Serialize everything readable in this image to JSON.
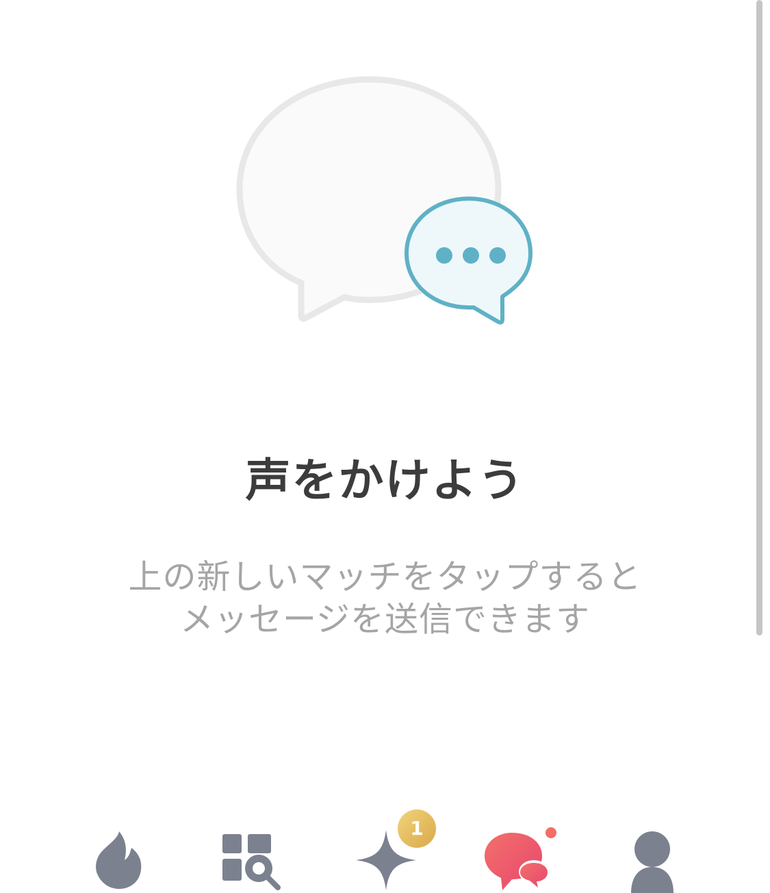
{
  "empty_state": {
    "title": "声をかけよう",
    "subtitle_line1": "上の新しいマッチをタップすると",
    "subtitle_line2": "メッセージを送信できます",
    "illustration_icon": "chat-bubbles-icon",
    "colors": {
      "bubble_outline": "#e6e6e6",
      "bubble_fill": "#fafafa",
      "accent_outline": "#5fb1c6",
      "accent_fill": "#eef8fb"
    }
  },
  "tabbar": {
    "tabs": [
      {
        "id": "home",
        "icon": "flame-icon",
        "active": false
      },
      {
        "id": "explore",
        "icon": "explore-search-icon",
        "active": false
      },
      {
        "id": "gold",
        "icon": "sparkle-icon",
        "active": false,
        "badge": "1"
      },
      {
        "id": "messages",
        "icon": "chat-icon",
        "active": true,
        "has_notification": true
      },
      {
        "id": "profile",
        "icon": "person-icon",
        "active": false
      }
    ],
    "colors": {
      "inactive": "#7b818e",
      "active_start": "#f2716a",
      "active_end": "#e8456f",
      "badge": "#e4bb5c",
      "notification": "#f36e66"
    }
  }
}
